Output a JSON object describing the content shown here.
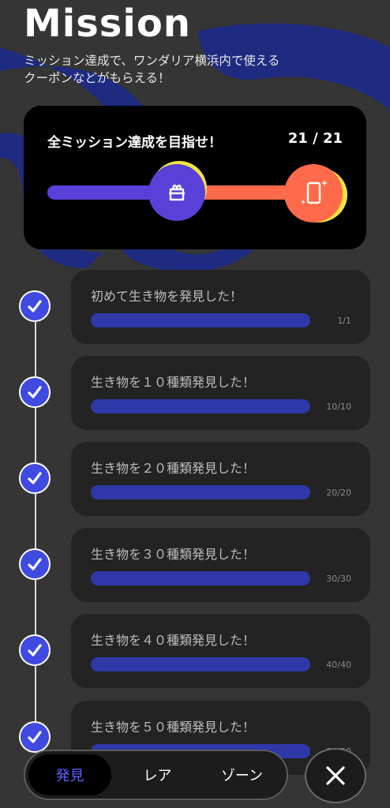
{
  "header": {
    "logo_text": "Mission",
    "subtitle_line1": "ミッション達成で、ワンダリア横浜内で使える",
    "subtitle_line2": "クーポンなどがもらえる！"
  },
  "summary_card": {
    "title": "全ミッション達成を目指せ！",
    "count": "21 / 21",
    "progress_fraction": 1.0,
    "milestone_icon": "gift-box-icon",
    "reward_icon": "smartphone-icon"
  },
  "missions": [
    {
      "label": "初めて生き物を発見した！",
      "progress": "1/1",
      "completed": true
    },
    {
      "label": "生き物を１０種類発見した！",
      "progress": "10/10",
      "completed": true
    },
    {
      "label": "生き物を２０種類発見した！",
      "progress": "20/20",
      "completed": true
    },
    {
      "label": "生き物を３０種類発見した！",
      "progress": "30/30",
      "completed": true
    },
    {
      "label": "生き物を４０種類発見した！",
      "progress": "40/40",
      "completed": true
    },
    {
      "label": "生き物を５０種類発見した！",
      "progress": "50/50",
      "completed": true
    }
  ],
  "bottom_nav": {
    "tabs": [
      {
        "label": "発見",
        "active": true
      },
      {
        "label": "レア",
        "active": false
      },
      {
        "label": "ゾーン",
        "active": false
      }
    ],
    "close_icon": "close-icon"
  },
  "colors": {
    "accent_purple": "#5a3fd8",
    "accent_orange": "#ff6a4a",
    "accent_yellow": "#f4e542",
    "bar_blue": "#2e38a8",
    "check_blue": "#3f4ae0",
    "active_tab_text": "#5b62ff"
  }
}
